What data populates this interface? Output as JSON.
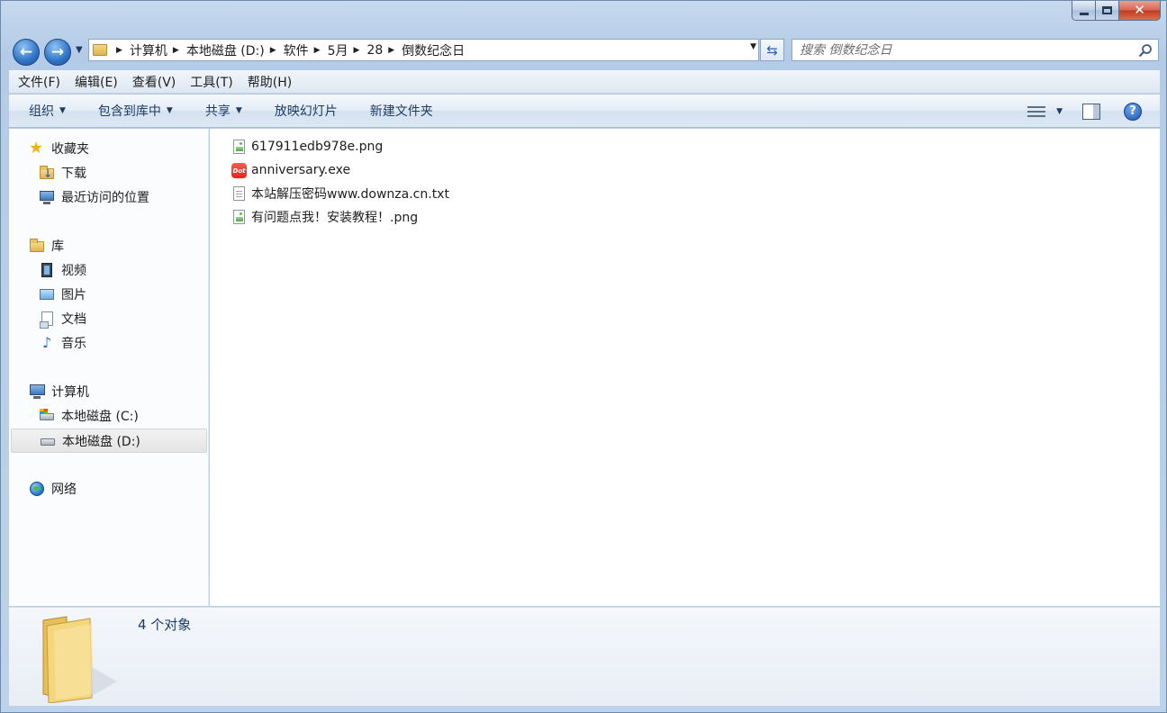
{
  "window": {
    "title": "倒数纪念日"
  },
  "nav": {
    "breadcrumbs": [
      "计算机",
      "本地磁盘 (D:)",
      "软件",
      "5月",
      "28",
      "倒数纪念日"
    ],
    "search_placeholder": "搜索 倒数纪念日"
  },
  "menu": [
    "文件(F)",
    "编辑(E)",
    "查看(V)",
    "工具(T)",
    "帮助(H)"
  ],
  "commands": [
    {
      "label": "组织",
      "dropdown": true
    },
    {
      "label": "包含到库中",
      "dropdown": true
    },
    {
      "label": "共享",
      "dropdown": true
    },
    {
      "label": "放映幻灯片",
      "dropdown": false
    },
    {
      "label": "新建文件夹",
      "dropdown": false
    }
  ],
  "sidebar": {
    "favorites": {
      "label": "收藏夹",
      "icon": "star-icon",
      "items": [
        {
          "label": "下载",
          "icon": "downloads-folder-icon"
        },
        {
          "label": "最近访问的位置",
          "icon": "recent-places-icon"
        }
      ]
    },
    "libraries": {
      "label": "库",
      "icon": "libraries-icon",
      "items": [
        {
          "label": "视频",
          "icon": "video-library-icon"
        },
        {
          "label": "图片",
          "icon": "pictures-library-icon"
        },
        {
          "label": "文档",
          "icon": "documents-library-icon"
        },
        {
          "label": "音乐",
          "icon": "music-library-icon"
        }
      ]
    },
    "computer": {
      "label": "计算机",
      "icon": "computer-icon",
      "items": [
        {
          "label": "本地磁盘 (C:)",
          "icon": "system-drive-icon"
        },
        {
          "label": "本地磁盘 (D:)",
          "icon": "drive-icon",
          "selected": true
        }
      ]
    },
    "network": {
      "label": "网络",
      "icon": "network-icon"
    }
  },
  "files": [
    {
      "name": "617911edb978e.png",
      "icon": "png-file-icon"
    },
    {
      "name": "anniversary.exe",
      "icon": "exe-app-icon"
    },
    {
      "name": "本站解压密码www.downza.cn.txt",
      "icon": "txt-file-icon"
    },
    {
      "name": "有问题点我！安装教程！.png",
      "icon": "png-file-icon"
    }
  ],
  "status": {
    "count_text": "4 个对象"
  },
  "colors": {
    "frame": "#b9cfe8",
    "selection": "#e4e4e4",
    "link_text": "#1e3b62"
  }
}
